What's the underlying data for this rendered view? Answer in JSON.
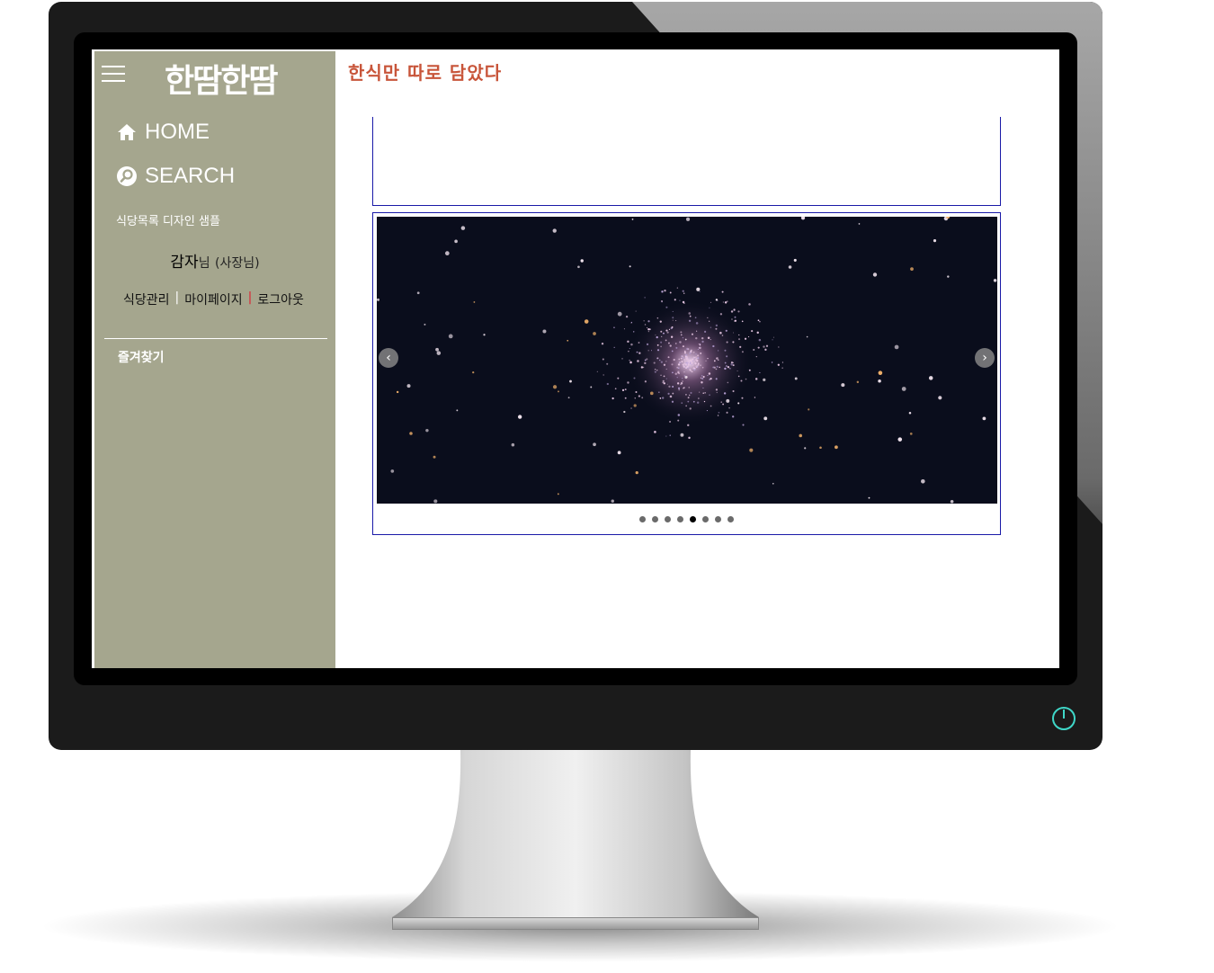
{
  "sidebar": {
    "logo": "한땀한땀",
    "nav": [
      {
        "label": "HOME",
        "icon": "home-icon"
      },
      {
        "label": "SEARCH",
        "icon": "search-icon"
      }
    ],
    "sample_link": "식당목록 디자인 샘플",
    "user": {
      "name": "감자",
      "suffix_nim": "님",
      "role": "(사장님)"
    },
    "user_links": [
      "식당관리",
      "마이페이지",
      "로그아웃"
    ],
    "favorites": "즐겨찾기"
  },
  "main": {
    "tagline": "한식만 따로 담았다",
    "slider": {
      "image_subject": "star cluster photo",
      "dot_count": 8,
      "active_dot": 5
    }
  },
  "colors": {
    "sidebar_bg": "#a5a68e",
    "tagline": "#c8553a",
    "box_border": "#1a1aa8",
    "power_icon": "#3fd7c8"
  }
}
